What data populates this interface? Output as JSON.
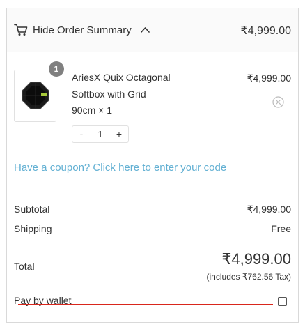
{
  "summary": {
    "toggle_label": "Hide Order Summary",
    "header_total": "₹4,999.00",
    "cart_icon": "cart-icon",
    "chevron_icon": "chevron-up-icon"
  },
  "cart": {
    "items": [
      {
        "quantity_badge": "1",
        "name": "AriesX Quix Octagonal Softbox with Grid",
        "variant": "90cm × 1",
        "price": "₹4,999.00",
        "quantity": "1",
        "decrement_label": "-",
        "increment_label": "+"
      }
    ]
  },
  "coupon": {
    "link_text": "Have a coupon? Click here to enter your code"
  },
  "totals": {
    "subtotal_label": "Subtotal",
    "subtotal_value": "₹4,999.00",
    "shipping_label": "Shipping",
    "shipping_value": "Free",
    "total_label": "Total",
    "total_value": "₹4,999.00",
    "tax_note": "(includes ₹762.56 Tax)"
  },
  "wallet": {
    "label": "Pay by wallet",
    "checked": false
  },
  "colors": {
    "link": "#62b0d3",
    "badge": "#808080",
    "underline": "#d9261c",
    "header_bg": "#fafafa",
    "border": "#e1e1e1"
  }
}
